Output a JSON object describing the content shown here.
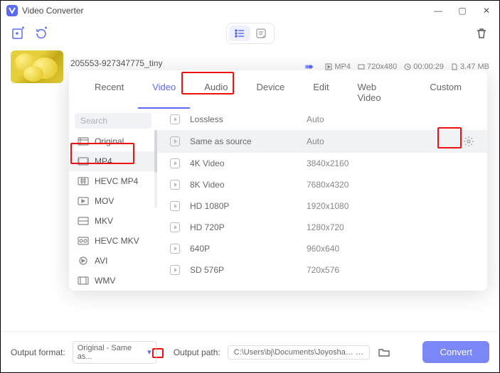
{
  "app": {
    "title": "Video Converter"
  },
  "file": {
    "name": "205553-927347775_tiny",
    "format": "MP4",
    "dimensions": "720x480",
    "duration": "00:00:29",
    "size": "3.47 MB"
  },
  "tabs": [
    "Recent",
    "Video",
    "Audio",
    "Device",
    "Edit",
    "Web Video",
    "Custom"
  ],
  "active_tab": 1,
  "sidebar": {
    "search_placeholder": "Search",
    "items": [
      "Original",
      "MP4",
      "HEVC MP4",
      "MOV",
      "MKV",
      "HEVC MKV",
      "AVI",
      "WMV"
    ],
    "active": 1
  },
  "presets": [
    {
      "name": "Lossless",
      "res": "Auto"
    },
    {
      "name": "Same as source",
      "res": "Auto",
      "selected": true
    },
    {
      "name": "4K Video",
      "res": "3840x2160"
    },
    {
      "name": "8K Video",
      "res": "7680x4320"
    },
    {
      "name": "HD 1080P",
      "res": "1920x1080"
    },
    {
      "name": "HD 720P",
      "res": "1280x720"
    },
    {
      "name": "640P",
      "res": "960x640"
    },
    {
      "name": "SD 576P",
      "res": "720x576"
    }
  ],
  "footer": {
    "format_label": "Output format:",
    "format_value": "Original - Same as...",
    "path_label": "Output path:",
    "path_value": "C:\\Users\\bj\\Documents\\Joyoshare Vidik",
    "convert": "Convert"
  }
}
